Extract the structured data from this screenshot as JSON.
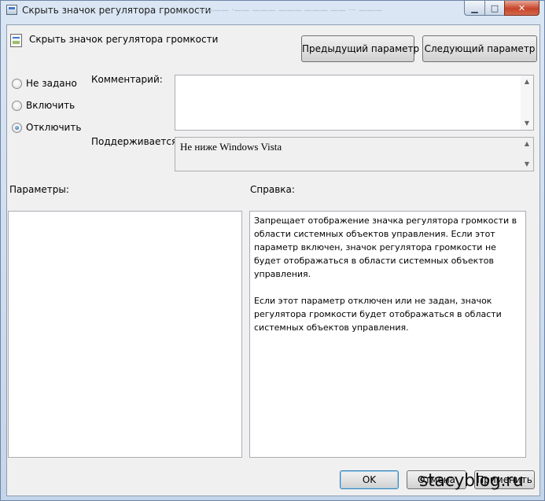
{
  "window": {
    "title": "Скрыть значок регулятора громкости",
    "background_title_text": "———— ·—— ——— ——— ——— —— ··· ———",
    "controls": {
      "minimize": "▁",
      "maximize": "□",
      "close": "✕"
    }
  },
  "policy": {
    "name": "Скрыть значок регулятора громкости",
    "icon": "policy-setting-icon"
  },
  "nav": {
    "prev_label": "Предыдущий параметр",
    "next_label": "Следующий параметр"
  },
  "state": {
    "options": [
      {
        "label": "Не задано",
        "checked": false
      },
      {
        "label": "Включить",
        "checked": false
      },
      {
        "label": "Отключить",
        "checked": true
      }
    ]
  },
  "comment": {
    "label": "Комментарий:",
    "value": ""
  },
  "supported": {
    "label": "Поддерживается:",
    "value": "Не ниже Windows Vista"
  },
  "options_panel": {
    "label": "Параметры:"
  },
  "help": {
    "label": "Справка:",
    "paragraphs": [
      "Запрещает отображение значка регулятора громкости в области системных объектов управления. Если этот параметр включен, значок регулятора громкости не будет отображаться в области системных объектов управления.",
      "Если этот параметр отключен или не задан, значок регулятора громкости будет отображаться в области системных объектов управления."
    ]
  },
  "footer": {
    "ok_label": "OK",
    "cancel_label": "Отмена",
    "apply_label": "Применить"
  },
  "watermark": "stacyblog.ru"
}
